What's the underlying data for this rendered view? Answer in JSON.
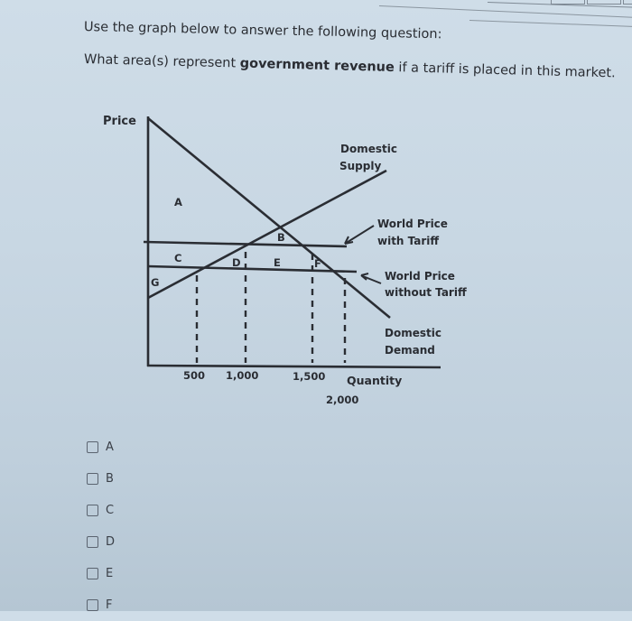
{
  "question": {
    "line1": "Use the graph below to answer the following question:",
    "line2_prefix": "What area(s) represent ",
    "line2_bold": "government revenue",
    "line2_suffix": " if a tariff is placed in this market."
  },
  "chart_data": {
    "type": "line",
    "title": "",
    "xlabel": "Quantity",
    "ylabel": "Price",
    "x_ticks": [
      "500",
      "1,000",
      "1,500",
      "2,000"
    ],
    "x_tick_values": [
      500,
      1000,
      1500,
      2000
    ],
    "series": [
      {
        "name": "Domestic Supply",
        "label": "Domestic Supply",
        "description": "upward-sloping supply curve"
      },
      {
        "name": "Domestic Demand",
        "label": "Domestic Demand",
        "description": "downward-sloping demand curve"
      },
      {
        "name": "World Price with Tariff",
        "label": "World Price\nwith Tariff",
        "supply_qty": 1000,
        "demand_qty": 1500
      },
      {
        "name": "World Price without Tariff",
        "label": "World Price\nwithout Tariff",
        "supply_qty": 500,
        "demand_qty": 2000
      }
    ],
    "annotations": {
      "areas": [
        "A",
        "B",
        "C",
        "D",
        "E",
        "F",
        "G"
      ],
      "supply_label_line1": "Domestic",
      "supply_label_line2": "Supply",
      "demand_label_line1": "Domestic",
      "demand_label_line2": "Demand",
      "wpt_line1": "World Price",
      "wpt_line2": "with Tariff",
      "wp_line1": "World Price",
      "wp_line2": "without Tariff"
    },
    "dashed_verticals_at": [
      500,
      1000,
      1500,
      2000
    ]
  },
  "options": [
    {
      "label": "A",
      "checked": false
    },
    {
      "label": "B",
      "checked": false
    },
    {
      "label": "C",
      "checked": false
    },
    {
      "label": "D",
      "checked": false
    },
    {
      "label": "E",
      "checked": false
    },
    {
      "label": "F",
      "checked": false
    }
  ]
}
